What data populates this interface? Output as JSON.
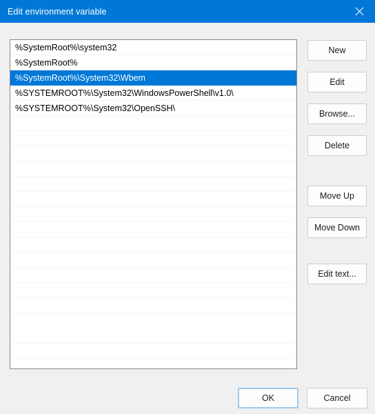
{
  "window": {
    "title": "Edit environment variable",
    "close_icon": "close-icon"
  },
  "colors": {
    "accent": "#0078d7",
    "titlebar_bg": "#0078d7",
    "titlebar_text": "#ffffff",
    "dialog_bg": "#f0f0f0",
    "listbox_bg": "#ffffff",
    "listbox_border": "#828790",
    "selection_bg": "#0078d7",
    "selection_text": "#ffffff",
    "button_bg": "#fdfdfd",
    "button_border": "#cccccc",
    "default_button_border": "#a0c8e8"
  },
  "listbox": {
    "items": [
      {
        "text": "%SystemRoot%\\system32",
        "selected": false
      },
      {
        "text": "%SystemRoot%",
        "selected": false
      },
      {
        "text": "%SystemRoot%\\System32\\Wbem",
        "selected": true
      },
      {
        "text": "%SYSTEMROOT%\\System32\\WindowsPowerShell\\v1.0\\",
        "selected": false
      },
      {
        "text": "%SYSTEMROOT%\\System32\\OpenSSH\\",
        "selected": false
      }
    ],
    "empty_row_count": 16,
    "selected_index": 2
  },
  "side_buttons": [
    {
      "id": "new",
      "label": "New"
    },
    {
      "id": "edit",
      "label": "Edit"
    },
    {
      "id": "browse",
      "label": "Browse..."
    },
    {
      "id": "delete",
      "label": "Delete"
    },
    {
      "id": "move-up",
      "label": "Move Up"
    },
    {
      "id": "move-down",
      "label": "Move Down"
    },
    {
      "id": "edit-text",
      "label": "Edit text..."
    }
  ],
  "bottom_buttons": {
    "ok_label": "OK",
    "cancel_label": "Cancel",
    "default_button": "OK"
  }
}
